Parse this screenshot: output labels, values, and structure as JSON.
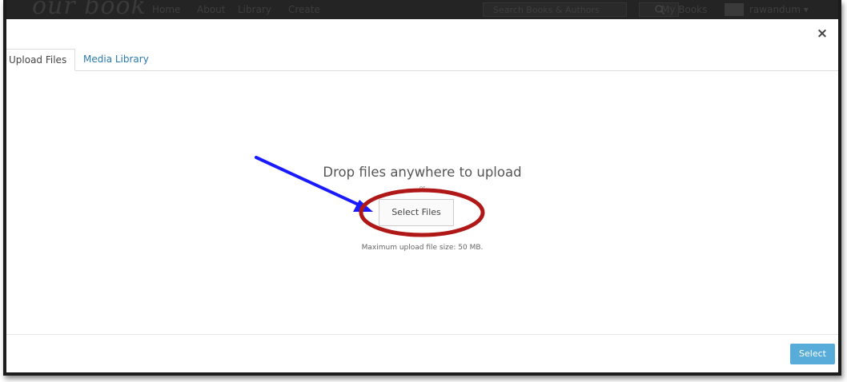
{
  "navbar": {
    "logo": "our book",
    "links": [
      "Home",
      "About",
      "Library",
      "Create"
    ],
    "search_placeholder": "Search Books & Authors",
    "my_books": "My Books",
    "user": "rawandum ▾"
  },
  "modal": {
    "close": "×",
    "tabs": [
      {
        "label": "Upload Files",
        "active": true
      },
      {
        "label": "Media Library",
        "active": false
      }
    ],
    "drop_title": "Drop files anywhere to upload",
    "drop_or": "or",
    "select_files_label": "Select Files",
    "max_size_text": "Maximum upload file size: 50 MB.",
    "select_button_label": "Select"
  },
  "colors": {
    "accent": "#3c9ed3",
    "tab_link": "#2a7ab0",
    "annotation_arrow": "#1a1aff",
    "annotation_ellipse": "#b01818"
  }
}
